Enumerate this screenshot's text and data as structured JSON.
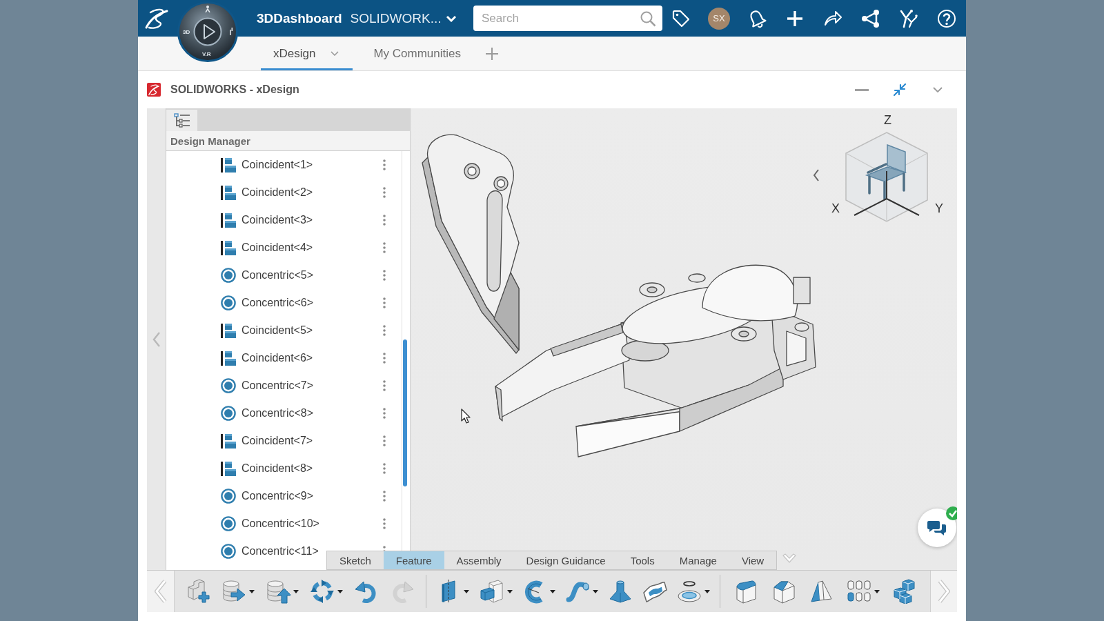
{
  "top_bar": {
    "compass": {
      "left_label": "3D",
      "bottom_label": "V.R"
    },
    "app_name": "3DDashboard",
    "dashboard": "SOLIDWORK...",
    "search": {
      "placeholder": "Search"
    },
    "avatar": "SX"
  },
  "tabs": [
    {
      "label": "xDesign",
      "selected": true,
      "menu": true
    },
    {
      "label": "My Communities",
      "selected": false,
      "menu": false
    }
  ],
  "app": {
    "title": "SOLIDWORKS - xDesign",
    "design_manager": {
      "title": "Design Manager",
      "items": [
        {
          "label": "Coincident<1>",
          "kind": "coincident"
        },
        {
          "label": "Coincident<2>",
          "kind": "coincident"
        },
        {
          "label": "Coincident<3>",
          "kind": "coincident"
        },
        {
          "label": "Coincident<4>",
          "kind": "coincident"
        },
        {
          "label": "Concentric<5>",
          "kind": "concentric"
        },
        {
          "label": "Concentric<6>",
          "kind": "concentric"
        },
        {
          "label": "Coincident<5>",
          "kind": "coincident"
        },
        {
          "label": "Coincident<6>",
          "kind": "coincident"
        },
        {
          "label": "Concentric<7>",
          "kind": "concentric"
        },
        {
          "label": "Concentric<8>",
          "kind": "concentric"
        },
        {
          "label": "Coincident<7>",
          "kind": "coincident"
        },
        {
          "label": "Coincident<8>",
          "kind": "coincident"
        },
        {
          "label": "Concentric<9>",
          "kind": "concentric"
        },
        {
          "label": "Concentric<10>",
          "kind": "concentric"
        },
        {
          "label": "Concentric<11>",
          "kind": "concentric"
        }
      ]
    },
    "view_cube": {
      "z": "Z",
      "x": "X",
      "y": "Y"
    },
    "command_tabs": [
      {
        "label": "Sketch",
        "selected": false
      },
      {
        "label": "Feature",
        "selected": true
      },
      {
        "label": "Assembly",
        "selected": false
      },
      {
        "label": "Design Guidance",
        "selected": false
      },
      {
        "label": "Tools",
        "selected": false
      },
      {
        "label": "Manage",
        "selected": false
      },
      {
        "label": "View",
        "selected": false
      }
    ],
    "toolbar": {
      "groups": [
        [
          {
            "kind": "block-plus",
            "dropdown": false,
            "disabled": false
          },
          {
            "kind": "cylinder-arrow-right",
            "dropdown": true,
            "disabled": false
          },
          {
            "kind": "cylinder-arrow-up",
            "dropdown": true,
            "disabled": false
          },
          {
            "kind": "cycle-arrows",
            "dropdown": true,
            "disabled": false
          },
          {
            "kind": "undo",
            "dropdown": false,
            "disabled": false
          },
          {
            "kind": "redo",
            "dropdown": false,
            "disabled": true
          }
        ],
        [
          {
            "kind": "plane",
            "dropdown": true,
            "disabled": false
          },
          {
            "kind": "box",
            "dropdown": true,
            "disabled": false
          },
          {
            "kind": "spiral",
            "dropdown": true,
            "disabled": false
          },
          {
            "kind": "pipe",
            "dropdown": true,
            "disabled": false
          },
          {
            "kind": "tapered-column",
            "dropdown": false,
            "disabled": false
          },
          {
            "kind": "wavy-sheet",
            "dropdown": false,
            "disabled": false
          },
          {
            "kind": "ring-disc",
            "dropdown": true,
            "disabled": false
          }
        ],
        [
          {
            "kind": "rounded-cube",
            "dropdown": false,
            "disabled": false
          },
          {
            "kind": "chamfered-cube",
            "dropdown": false,
            "disabled": false
          },
          {
            "kind": "wedge",
            "dropdown": false,
            "disabled": false
          },
          {
            "kind": "grid",
            "dropdown": true,
            "disabled": false
          },
          {
            "kind": "cubes",
            "dropdown": false,
            "disabled": false
          }
        ]
      ]
    }
  }
}
